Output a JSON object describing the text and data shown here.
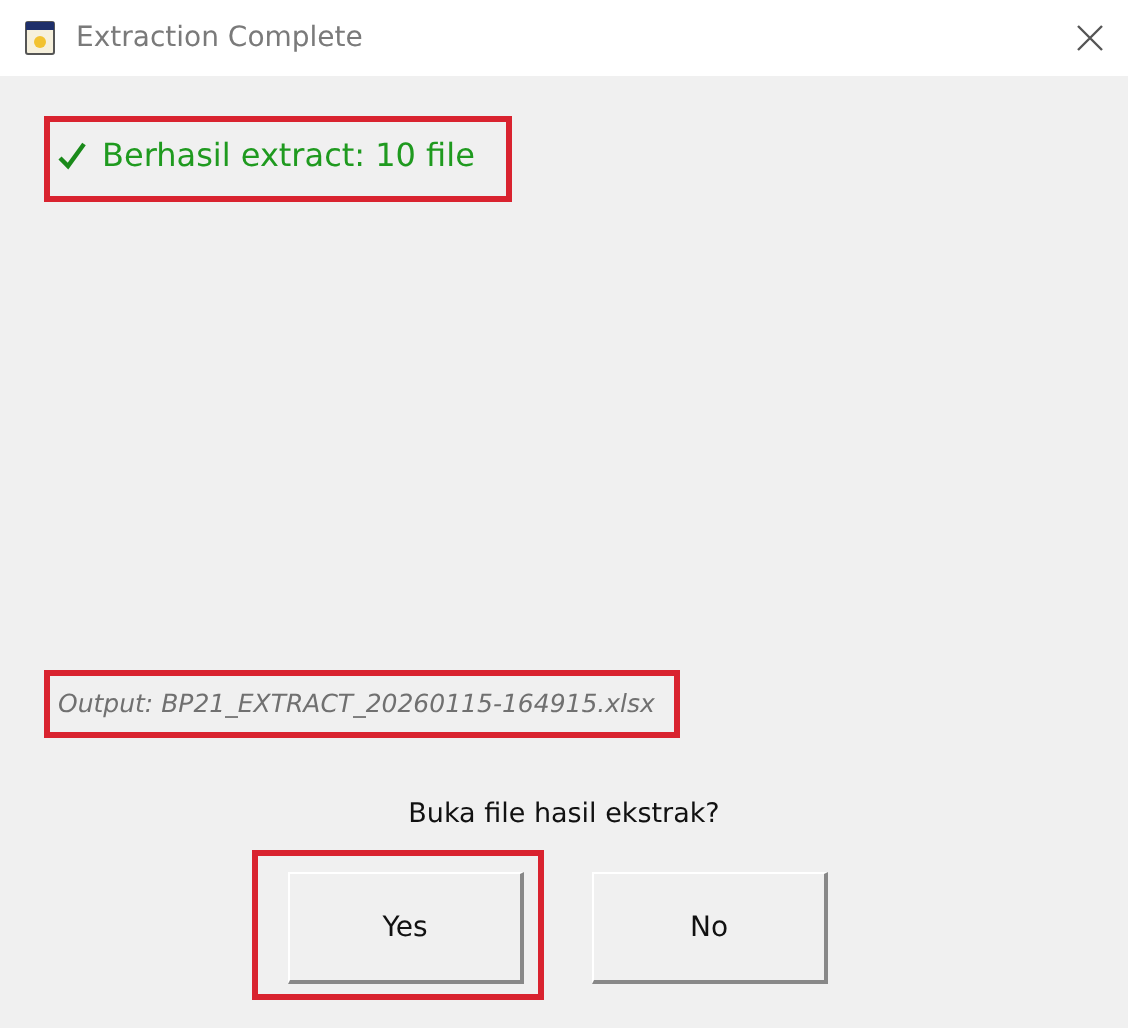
{
  "window": {
    "title": "Extraction Complete"
  },
  "message": {
    "text": "Berhasil extract: 10 file",
    "highlighted": true
  },
  "output": {
    "text": "Output: BP21_EXTRACT_20260115-164915.xlsx",
    "highlighted": true
  },
  "question": "Buka file hasil ekstrak?",
  "buttons": [
    {
      "label": "Yes",
      "highlighted": true
    },
    {
      "label": "No",
      "highlighted": false
    }
  ]
}
